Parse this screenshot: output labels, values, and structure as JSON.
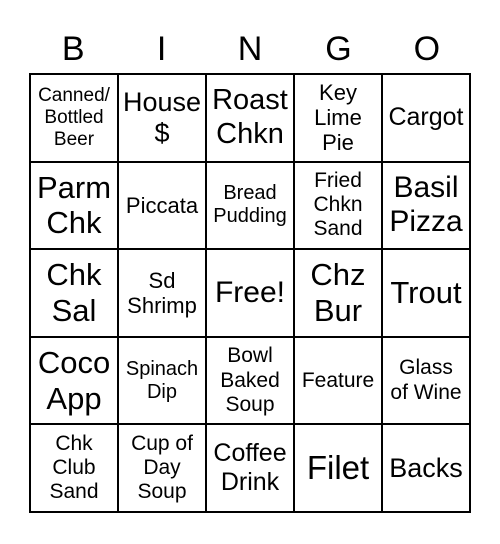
{
  "header": [
    "B",
    "I",
    "N",
    "G",
    "O"
  ],
  "cells": [
    "Canned/\nBottled\nBeer",
    "House\n$",
    "Roast\nChkn",
    "Key\nLime\nPie",
    "Cargot",
    "Parm\nChk",
    "Piccata",
    "Bread\nPudding",
    "Fried\nChkn\nSand",
    "Basil\nPizza",
    "Chk\nSal",
    "Sd\nShrimp",
    "Free!",
    "Chz\nBur",
    "Trout",
    "Coco\nApp",
    "Spinach\nDip",
    "Bowl\nBaked\nSoup",
    "Feature",
    "Glass\nof Wine",
    "Chk\nClub\nSand",
    "Cup of\nDay\nSoup",
    "Coffee\nDrink",
    "Filet",
    "Backs"
  ]
}
